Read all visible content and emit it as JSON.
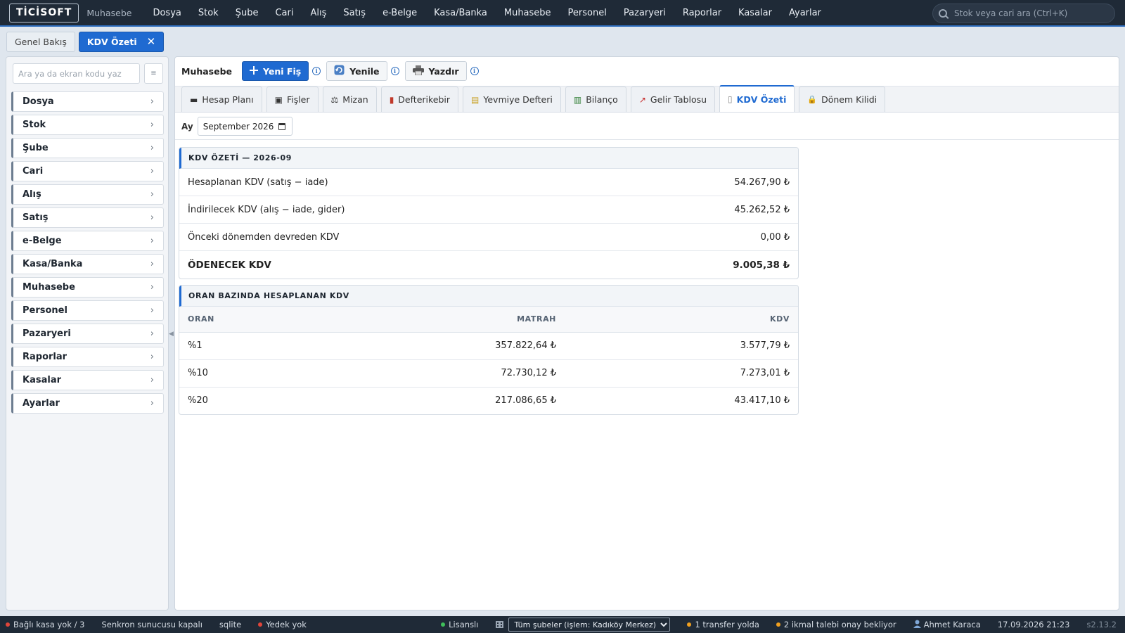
{
  "topbar": {
    "logo": "TİCİSOFT",
    "module": "Muhasebe",
    "menu": [
      "Dosya",
      "Stok",
      "Şube",
      "Cari",
      "Alış",
      "Satış",
      "e-Belge",
      "Kasa/Banka",
      "Muhasebe",
      "Personel",
      "Pazaryeri",
      "Raporlar",
      "Kasalar",
      "Ayarlar"
    ],
    "search_placeholder": "Stok veya cari ara (Ctrl+K)"
  },
  "page_tabs": [
    {
      "label": "Genel Bakış",
      "active": false
    },
    {
      "label": "KDV Özeti",
      "active": true,
      "close": "✕"
    }
  ],
  "sidebar": {
    "search_placeholder": "Ara ya da ekran kodu yaz",
    "menu_icon": "≡",
    "items": [
      "Dosya",
      "Stok",
      "Şube",
      "Cari",
      "Alış",
      "Satış",
      "e-Belge",
      "Kasa/Banka",
      "Muhasebe",
      "Personel",
      "Pazaryeri",
      "Raporlar",
      "Kasalar",
      "Ayarlar"
    ],
    "chevron": "›",
    "collapse_glyph": "◀"
  },
  "toolbar": {
    "title": "Muhasebe",
    "new_label": "Yeni Fiş",
    "refresh_label": "Yenile",
    "print_label": "Yazdır",
    "info_glyph": "i"
  },
  "module_tabs": [
    {
      "label": "Hesap Planı",
      "icon": "ledger-icon",
      "glyph": "▬"
    },
    {
      "label": "Fişler",
      "icon": "receipt-icon",
      "glyph": "▣"
    },
    {
      "label": "Mizan",
      "icon": "scale-icon",
      "glyph": "⚖"
    },
    {
      "label": "Defterikebir",
      "icon": "book-icon",
      "glyph": "▮"
    },
    {
      "label": "Yevmiye Defteri",
      "icon": "journal-icon",
      "glyph": "▤"
    },
    {
      "label": "Bilanço",
      "icon": "bar-chart-icon",
      "glyph": "▥"
    },
    {
      "label": "Gelir Tablosu",
      "icon": "line-chart-icon",
      "glyph": "↗"
    },
    {
      "label": "KDV Özeti",
      "icon": "document-icon",
      "glyph": "▯",
      "active": true
    },
    {
      "label": "Dönem Kilidi",
      "icon": "lock-icon",
      "glyph": "🔒"
    }
  ],
  "filter": {
    "label": "Ay",
    "month_value": "September  2026"
  },
  "summary": {
    "title": "KDV ÖZETİ — 2026-09",
    "rows": [
      {
        "label": "Hesaplanan KDV (satış − iade)",
        "value": "54.267,90 ₺"
      },
      {
        "label": "İndirilecek KDV (alış − iade, gider)",
        "value": "45.262,52 ₺"
      },
      {
        "label": "Önceki dönemden devreden KDV",
        "value": "0,00 ₺"
      }
    ],
    "total": {
      "label": "ÖDENECEK KDV",
      "value": "9.005,38 ₺"
    }
  },
  "rates": {
    "title": "ORAN BAZINDA HESAPLANAN KDV",
    "columns": [
      "ORAN",
      "MATRAH",
      "KDV"
    ],
    "rows": [
      {
        "rate": "%1",
        "base": "357.822,64 ₺",
        "vat": "3.577,79 ₺"
      },
      {
        "rate": "%10",
        "base": "72.730,12 ₺",
        "vat": "7.273,01 ₺"
      },
      {
        "rate": "%20",
        "base": "217.086,65 ₺",
        "vat": "43.417,10 ₺"
      }
    ]
  },
  "status": {
    "cash": "Bağlı kasa yok / 3",
    "sync": "Senkron sunucusu kapalı",
    "db": "sqlite",
    "backup": "Yedek yok",
    "license": "Lisanslı",
    "branch": "Tüm şubeler (işlem: Kadıköy Merkez)",
    "transfer": "1 transfer yolda",
    "supply": "2 ikmal talebi onay bekliyor",
    "user": "Ahmet Karaca",
    "datetime": "17.09.2026 21:23",
    "version": "s2.13.2"
  },
  "colors": {
    "accent": "#1f6ad1",
    "topbar": "#1f2a37",
    "status_green": "#3fbf5a",
    "status_red": "#e0453a",
    "status_orange": "#f0a020"
  }
}
